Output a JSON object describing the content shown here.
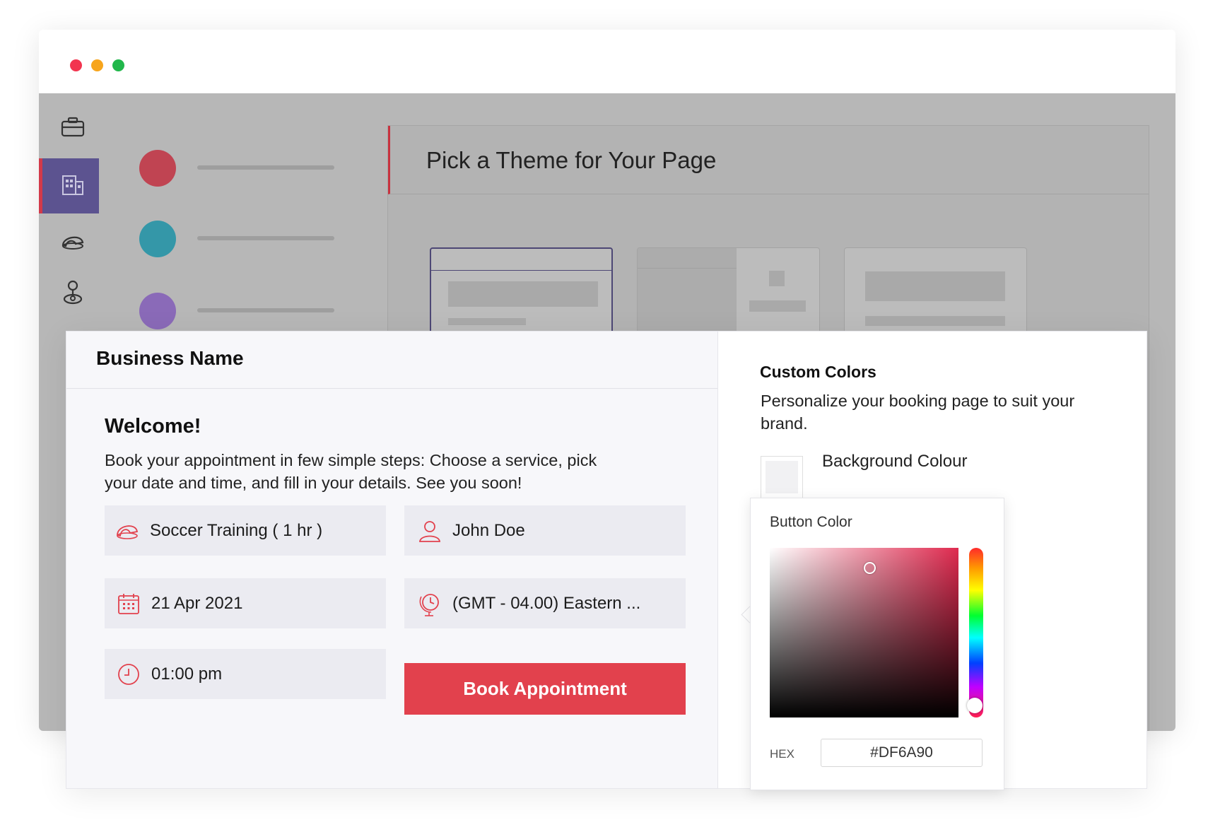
{
  "window": {
    "controls": [
      "close",
      "minimize",
      "maximize"
    ]
  },
  "sidebar": {
    "icons": [
      "briefcase-icon",
      "building-icon",
      "cap-icon",
      "user-pin-icon"
    ],
    "active_index": 1
  },
  "theme_panel": {
    "title": "Pick a Theme for Your Page"
  },
  "preview": {
    "business_name": "Business Name",
    "welcome_title": "Welcome!",
    "intro_text": "Book your appointment in few simple steps: Choose a service, pick your date and time, and fill in your details. See you soon!",
    "fields": {
      "service": "Soccer Training ( 1 hr )",
      "staff": "John Doe",
      "date": "21  Apr 2021",
      "timezone": "(GMT - 04.00) Eastern ...",
      "time": "01:00 pm"
    },
    "book_button": "Book Appointment"
  },
  "custom_colors": {
    "title": "Custom Colors",
    "description": "Personalize your booking page to suit your brand.",
    "background_label": "Background Colour",
    "swatches": {
      "background": "#F1F1F3",
      "text": "#2C2C2C",
      "button": "#DF6A90"
    }
  },
  "color_picker": {
    "title": "Button Color",
    "hex_label": "HEX",
    "hex_value": "#DF6A90"
  },
  "colors": {
    "accent_red": "#E2414D",
    "nav_active": "#5C5390",
    "list_red": "#C04452",
    "list_teal": "#3497A8",
    "list_purple": "#8A6AB8"
  }
}
